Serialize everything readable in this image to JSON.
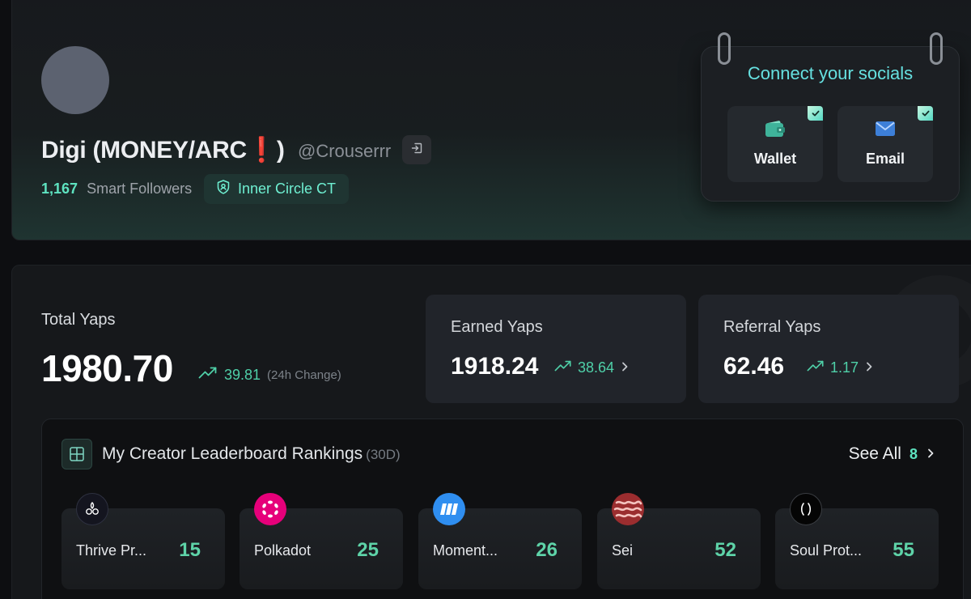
{
  "profile": {
    "display_name": "Digi (MONEY/ARC❗️)",
    "handle": "@Crouserrr",
    "smart_followers_count": "1,167",
    "smart_followers_label": "Smart Followers",
    "badge_label": "Inner Circle CT"
  },
  "socials": {
    "title": "Connect your socials",
    "wallet_label": "Wallet",
    "email_label": "Email"
  },
  "yaps": {
    "total_label": "Total Yaps",
    "total_value": "1980.70",
    "total_change": "39.81",
    "total_change_note": "(24h Change)",
    "earned_label": "Earned Yaps",
    "earned_value": "1918.24",
    "earned_change": "38.64",
    "referral_label": "Referral Yaps",
    "referral_value": "62.46",
    "referral_change": "1.17"
  },
  "leaderboard": {
    "title": "My Creator Leaderboard Rankings",
    "period": "(30D)",
    "see_all_label": "See All",
    "see_all_count": "8",
    "items": [
      {
        "name": "Thrive Pr...",
        "rank": "15"
      },
      {
        "name": "Polkadot",
        "rank": "25"
      },
      {
        "name": "Moment...",
        "rank": "26"
      },
      {
        "name": "Sei",
        "rank": "52"
      },
      {
        "name": "Soul Prot...",
        "rank": "55"
      }
    ]
  },
  "colors": {
    "accent": "#5ee3c0",
    "positive": "#4fd0a8",
    "socials_title": "#66e0e0"
  }
}
